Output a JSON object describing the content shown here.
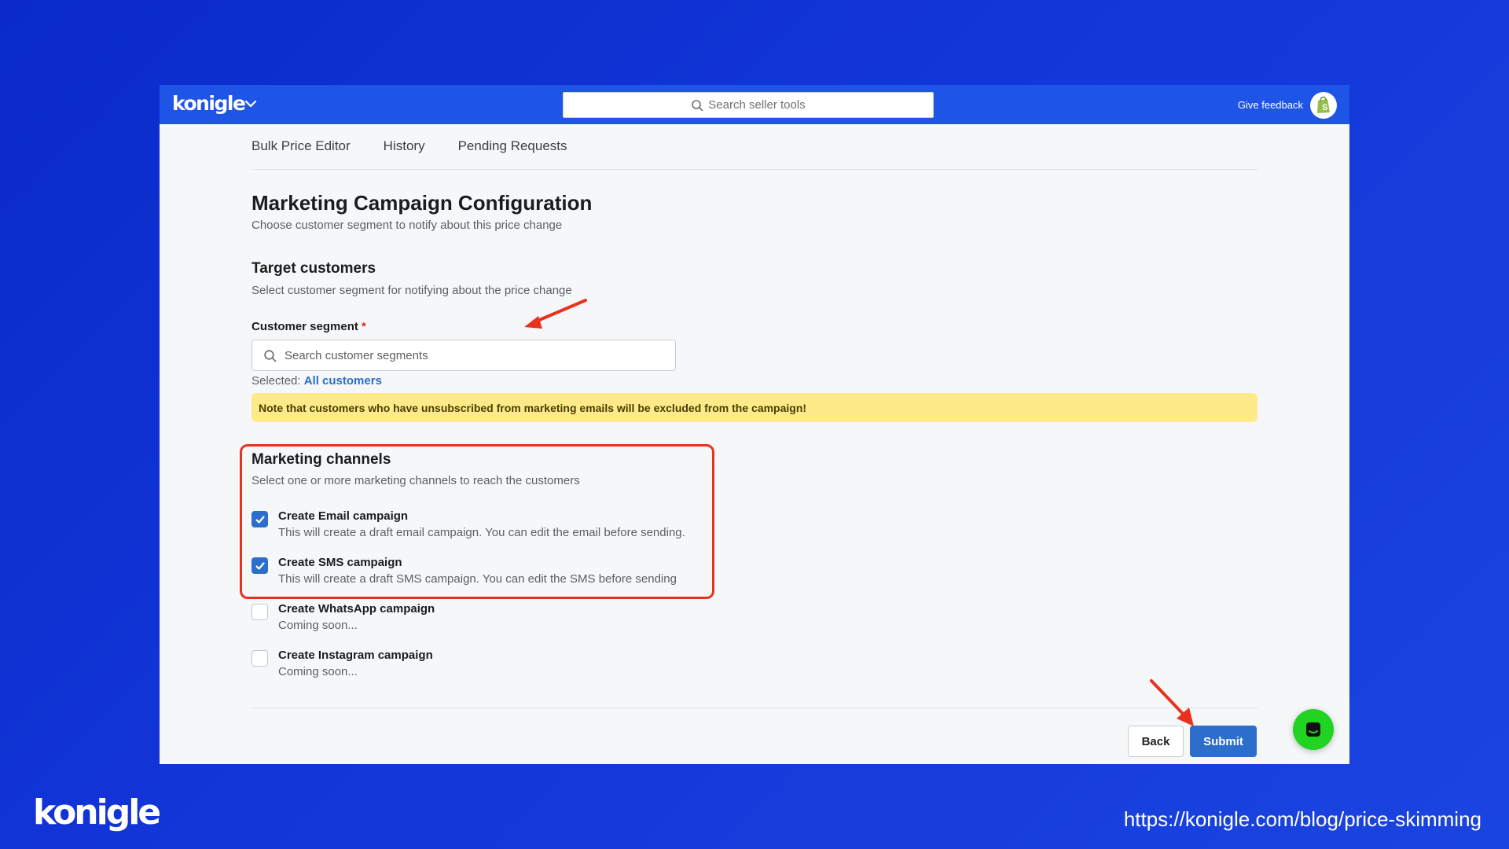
{
  "app": {
    "logo": "konigle",
    "search_placeholder": "Search seller tools",
    "feedback_label": "Give feedback"
  },
  "tabs": [
    {
      "label": "Bulk Price Editor"
    },
    {
      "label": "History"
    },
    {
      "label": "Pending Requests"
    }
  ],
  "page": {
    "title": "Marketing Campaign Configuration",
    "subtitle": "Choose customer segment to notify about this price change"
  },
  "target": {
    "title": "Target customers",
    "subtitle": "Select customer segment for notifying about the price change",
    "field_label": "Customer segment",
    "required_mark": "*",
    "search_placeholder": "Search customer segments",
    "selected_prefix": "Selected:",
    "selected_value": "All customers",
    "notice": "Note that customers who have unsubscribed from marketing emails will be excluded from the campaign!"
  },
  "channels": {
    "title": "Marketing channels",
    "subtitle": "Select one or more marketing channels to reach the customers",
    "items": [
      {
        "label": "Create Email campaign",
        "desc": "This will create a draft email campaign. You can edit the email before sending.",
        "checked": true
      },
      {
        "label": "Create SMS campaign",
        "desc": "This will create a draft SMS campaign. You can edit the SMS before sending",
        "checked": true
      },
      {
        "label": "Create WhatsApp campaign",
        "desc": "Coming soon...",
        "checked": false
      },
      {
        "label": "Create Instagram campaign",
        "desc": "Coming soon...",
        "checked": false
      }
    ]
  },
  "actions": {
    "back": "Back",
    "submit": "Submit"
  },
  "footer": {
    "brand": "konigle",
    "url": "https://konigle.com/blog/price-skimming"
  },
  "colors": {
    "primary": "#2c6ecb",
    "topbar": "#1f55e6",
    "annotation": "#e8321e",
    "notice": "#ffea8a",
    "chat": "#22d422"
  }
}
